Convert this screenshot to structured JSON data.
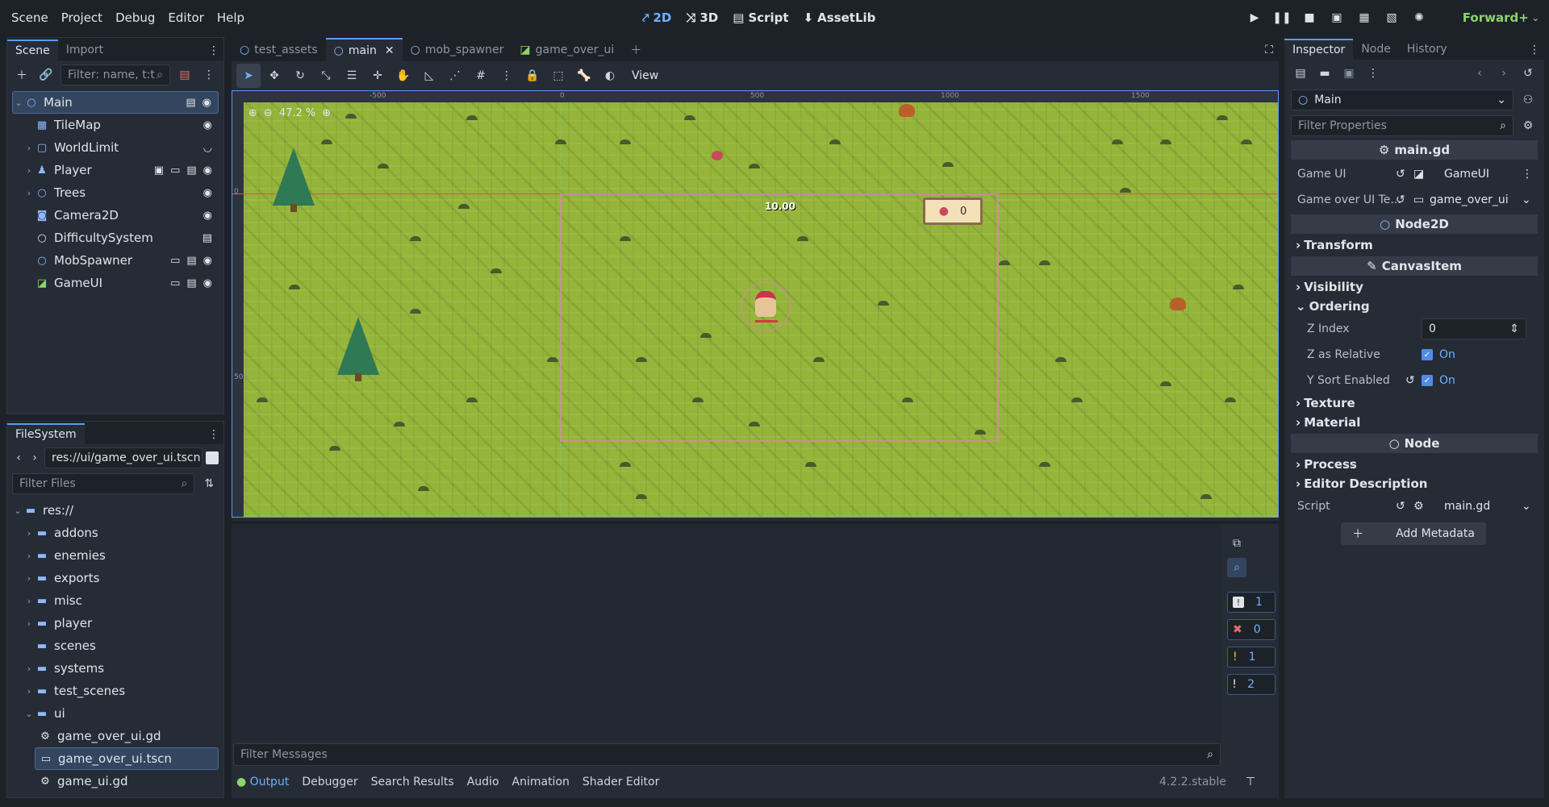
{
  "menu": [
    "Scene",
    "Project",
    "Debug",
    "Editor",
    "Help"
  ],
  "workspaces": [
    {
      "label": "2D",
      "icon": "2d-icon",
      "active": true
    },
    {
      "label": "3D",
      "icon": "3d-icon",
      "active": false
    },
    {
      "label": "Script",
      "icon": "script-icon",
      "active": false
    },
    {
      "label": "AssetLib",
      "icon": "assetlib-icon",
      "active": false
    }
  ],
  "renderer": "Forward+",
  "scene_dock": {
    "tabs": [
      "Scene",
      "Import"
    ],
    "filter_placeholder": "Filter: name, t:t",
    "nodes": [
      "Main",
      "TileMap",
      "WorldLimit",
      "Player",
      "Trees",
      "Camera2D",
      "DifficultySystem",
      "MobSpawner",
      "GameUI"
    ]
  },
  "filesystem": {
    "tab": "FileSystem",
    "path": "res://ui/game_over_ui.tscn",
    "filter_placeholder": "Filter Files",
    "items": [
      "res://",
      "addons",
      "enemies",
      "exports",
      "misc",
      "player",
      "scenes",
      "systems",
      "test_scenes",
      "ui",
      "game_over_ui.gd",
      "game_over_ui.tscn",
      "game_ui.gd"
    ]
  },
  "viewport": {
    "tabs": [
      "test_assets",
      "main",
      "mob_spawner",
      "game_over_ui"
    ],
    "view_label": "View",
    "zoom": "47.2 %",
    "timer": "10.00",
    "score": "0",
    "ruler_labels": [
      "-500",
      "0",
      "500",
      "1000",
      "1500"
    ],
    "ruler_v_labels": [
      "0",
      "500"
    ]
  },
  "bottom": {
    "filter_placeholder": "Filter Messages",
    "tabs": [
      "Output",
      "Debugger",
      "Search Results",
      "Audio",
      "Animation",
      "Shader Editor"
    ],
    "version": "4.2.2.stable",
    "counters": [
      "1",
      "0",
      "1",
      "2"
    ]
  },
  "inspector": {
    "tabs": [
      "Inspector",
      "Node",
      "History"
    ],
    "object_name": "Main",
    "filter_placeholder": "Filter Properties",
    "script_header": "main.gd",
    "game_ui_label": "Game UI",
    "game_ui_value": "GameUI",
    "game_over_label": "Game over UI Te...",
    "game_over_value": "game_over_ui",
    "node2d_header": "Node2D",
    "transform": "Transform",
    "canvasitem_header": "CanvasItem",
    "visibility": "Visibility",
    "ordering": "Ordering",
    "z_index_label": "Z Index",
    "z_index_value": "0",
    "z_relative_label": "Z as Relative",
    "y_sort_label": "Y Sort Enabled",
    "on_label": "On",
    "texture": "Texture",
    "material": "Material",
    "node_header": "Node",
    "process": "Process",
    "editor_description": "Editor Description",
    "script_label": "Script",
    "script_value": "main.gd",
    "add_metadata": "Add Metadata"
  }
}
